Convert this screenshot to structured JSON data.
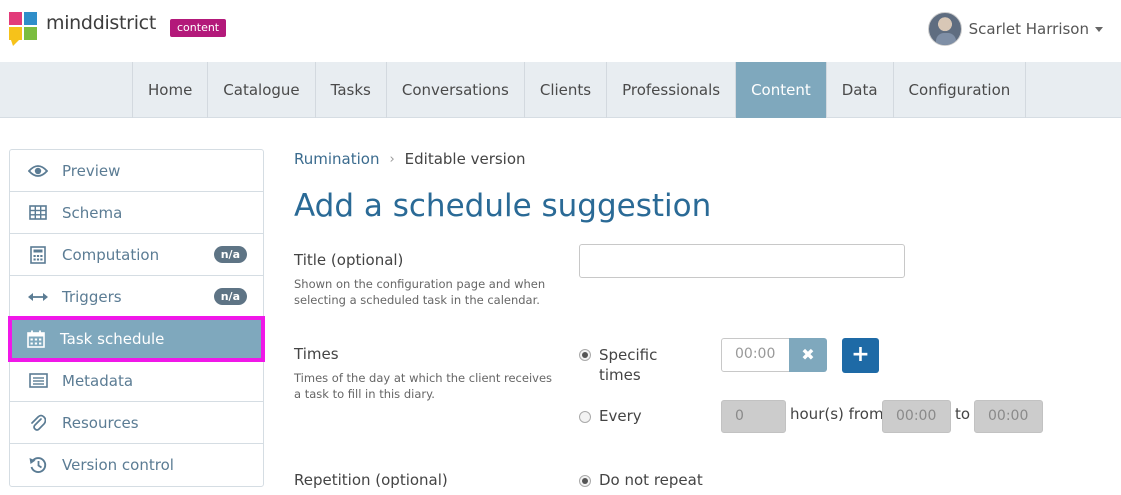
{
  "header": {
    "logo_text": "minddistrict",
    "badge": "content",
    "user_name": "Scarlet Harrison"
  },
  "nav": {
    "items": [
      "Home",
      "Catalogue",
      "Tasks",
      "Conversations",
      "Clients",
      "Professionals",
      "Content",
      "Data",
      "Configuration"
    ],
    "active": "Content"
  },
  "sidebar": {
    "items": [
      {
        "label": "Preview",
        "icon": "eye-icon"
      },
      {
        "label": "Schema",
        "icon": "table-icon"
      },
      {
        "label": "Computation",
        "icon": "calculator-icon",
        "badge": "n/a"
      },
      {
        "label": "Triggers",
        "icon": "arrows-horizontal-icon",
        "badge": "n/a"
      },
      {
        "label": "Task schedule",
        "icon": "calendar-icon",
        "active": true
      },
      {
        "label": "Metadata",
        "icon": "list-icon"
      },
      {
        "label": "Resources",
        "icon": "paperclip-icon"
      },
      {
        "label": "Version control",
        "icon": "history-icon"
      }
    ]
  },
  "breadcrumb": {
    "parent": "Rumination",
    "separator": "›",
    "current": "Editable version"
  },
  "main": {
    "title": "Add a schedule suggestion",
    "title_field": {
      "label": "Title (optional)",
      "help": "Shown on the configuration page and when selecting a scheduled task in the calendar.",
      "value": ""
    },
    "times": {
      "label": "Times",
      "help": "Times of the day at which the client receives a task to fill in this diary.",
      "specific_label": "Specific times",
      "specific_placeholder": "00:00",
      "clear_symbol": "✖",
      "add_symbol": "+",
      "every_label": "Every",
      "every_value": "0",
      "hours_from_text": "hour(s) from",
      "from_placeholder": "00:00",
      "to_text": "to",
      "to_placeholder": "00:00"
    },
    "repetition": {
      "label": "Repetition (optional)",
      "option_label": "Do not repeat"
    }
  },
  "colors": {
    "accent": "#7fa8bd",
    "brand_badge": "#b3197a",
    "title_blue": "#2a6a96",
    "primary_button": "#1e6aa6",
    "highlight_outline": "#f018e8"
  }
}
